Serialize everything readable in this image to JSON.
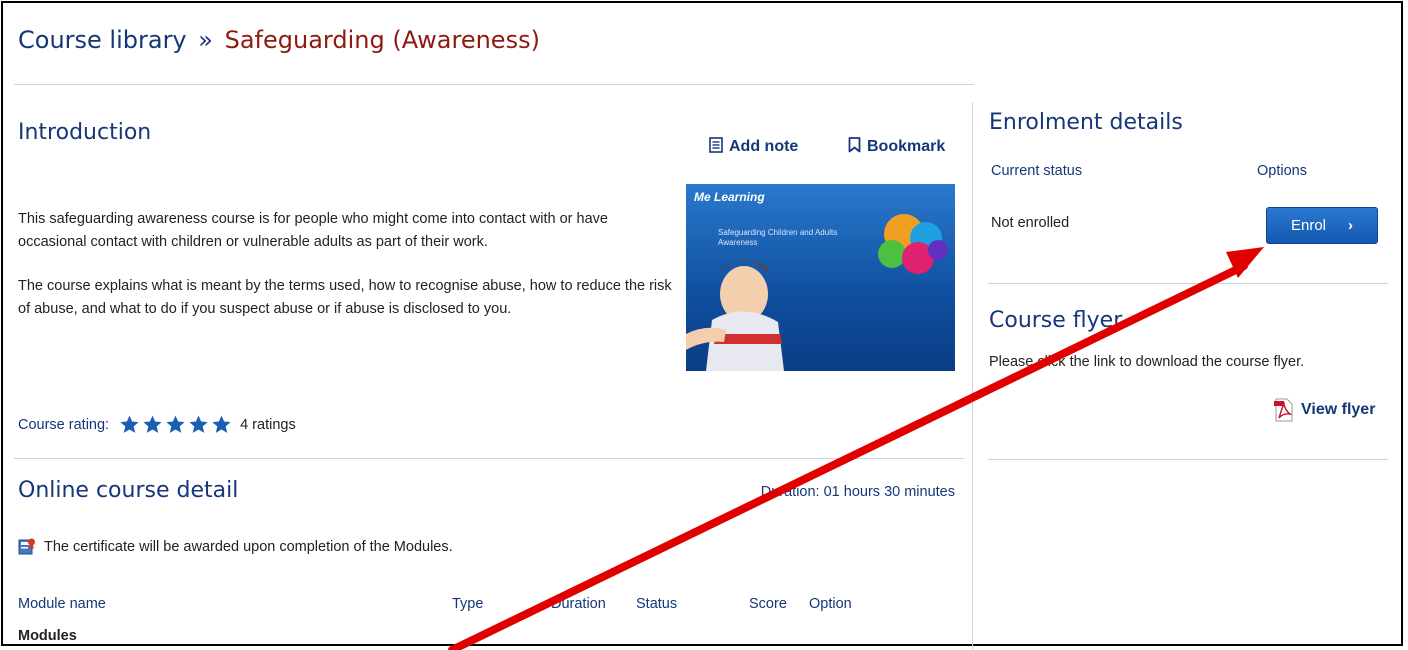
{
  "breadcrumb": {
    "parent": "Course library",
    "separator": "»",
    "current": "Safeguarding (Awareness)"
  },
  "introduction": {
    "heading": "Introduction",
    "add_note_label": "Add note",
    "bookmark_label": "Bookmark",
    "paragraph_1": "This safeguarding awareness course is for people who might come into contact with or have occasional contact with children or vulnerable adults as part of their work.",
    "paragraph_2": "The course explains what is meant by the terms used, how to recognise abuse, how to reduce the risk of abuse, and what to do if you suspect abuse or if abuse is disclosed to you.",
    "thumbnail": {
      "brand": "Me Learning",
      "caption": "Safeguarding Children and Adults Awareness"
    },
    "rating_label": "Course rating:",
    "rating_stars": 5,
    "rating_count": "4 ratings"
  },
  "online_course": {
    "heading": "Online course detail",
    "duration": "Duration: 01 hours 30 minutes",
    "certificate_note": "The certificate will be awarded upon completion of the Modules.",
    "table_headers": {
      "module_name": "Module name",
      "type": "Type",
      "duration": "Duration",
      "status": "Status",
      "score": "Score",
      "option": "Option"
    },
    "group_label": "Modules"
  },
  "enrolment": {
    "heading": "Enrolment details",
    "current_status_label": "Current status",
    "options_label": "Options",
    "status_value": "Not enrolled",
    "enrol_label": "Enrol",
    "enrol_chevron": "›"
  },
  "flyer": {
    "heading": "Course flyer",
    "description": "Please click the link to download the course flyer.",
    "view_label": "View flyer"
  },
  "icons": {
    "add_note": "note-icon",
    "bookmark": "bookmark-icon",
    "star": "star-icon",
    "certificate": "certificate-icon",
    "pdf": "pdf-icon"
  },
  "colors": {
    "heading_blue": "#15377a",
    "breadcrumb_current": "#8e1a10",
    "button_blue": "#1a63c0",
    "annotation_arrow": "#e00000"
  }
}
